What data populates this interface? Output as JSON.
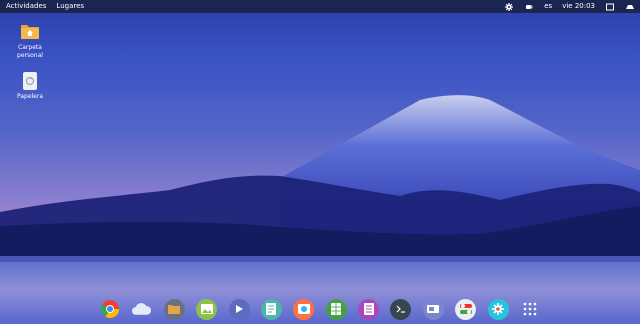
{
  "topbar": {
    "activities": "Actividades",
    "places": "Lugares",
    "language": "es",
    "clock": "vie 20:03"
  },
  "desktop": {
    "home_folder": "Carpeta\npersonal",
    "trash": "Papelera"
  },
  "dock": {
    "apps": [
      {
        "icon": "chrome-icon",
        "color": "#e94235"
      },
      {
        "icon": "cloud-icon",
        "color": "#dfe7f5"
      },
      {
        "icon": "files-icon",
        "color": "#6a6f86"
      },
      {
        "icon": "image-viewer-icon",
        "color": "#8bc34a"
      },
      {
        "icon": "video-player-icon",
        "color": "#5c6bc0"
      },
      {
        "icon": "document-viewer-icon",
        "color": "#4db6ac"
      },
      {
        "icon": "photos-icon",
        "color": "#ff7043"
      },
      {
        "icon": "spreadsheet-icon",
        "color": "#43a047"
      },
      {
        "icon": "text-editor-icon",
        "color": "#ab47bc"
      },
      {
        "icon": "terminal-icon",
        "color": "#37474f"
      },
      {
        "icon": "desktop-switch-icon",
        "color": "#7986cb"
      },
      {
        "icon": "settings-toggle-icon",
        "color": "#eceff1"
      },
      {
        "icon": "system-settings-icon",
        "color": "#26c6da"
      },
      {
        "icon": "app-grid-icon",
        "color": "#ffffff"
      }
    ]
  }
}
